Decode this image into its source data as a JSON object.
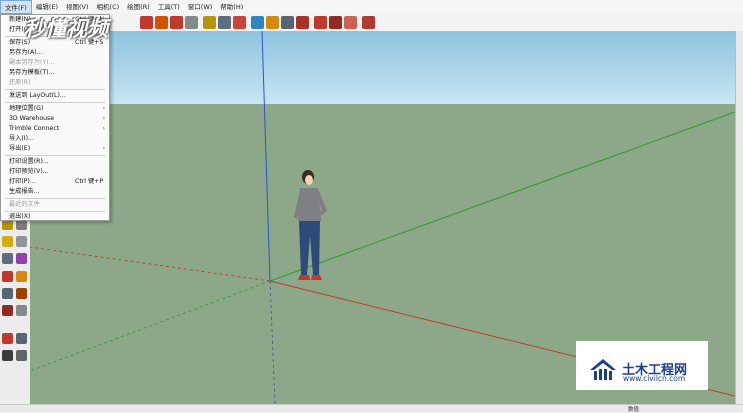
{
  "menu": {
    "items": [
      {
        "label": "文件(F)",
        "active": true
      },
      {
        "label": "编辑(E)"
      },
      {
        "label": "视图(V)"
      },
      {
        "label": "相机(C)"
      },
      {
        "label": "绘图(R)"
      },
      {
        "label": "工具(T)"
      },
      {
        "label": "窗口(W)"
      },
      {
        "label": "帮助(H)"
      }
    ]
  },
  "file_menu": {
    "items": [
      {
        "label": "新建(N)",
        "shortcut": "Ctrl 键+N"
      },
      {
        "label": "打开(O)...",
        "shortcut": ""
      },
      {
        "label": "保存(S)",
        "shortcut": "Ctrl 键+S"
      },
      {
        "label": "另存为(A)...",
        "shortcut": ""
      },
      {
        "label": "副本另存为(Y)...",
        "shortcut": "",
        "disabled": true
      },
      {
        "label": "另存为模板(T)...",
        "shortcut": ""
      },
      {
        "label": "还原(R)",
        "shortcut": "",
        "disabled": true
      },
      {
        "label": "发送到 LayOut(L)...",
        "shortcut": ""
      },
      {
        "label": "地理位置(G)",
        "submenu": true
      },
      {
        "label": "3D Warehouse",
        "submenu": true
      },
      {
        "label": "Trimble Connect",
        "submenu": true
      },
      {
        "label": "导入(I)...",
        "shortcut": ""
      },
      {
        "label": "导出(E)",
        "submenu": true
      },
      {
        "label": "打印设置(R)...",
        "shortcut": ""
      },
      {
        "label": "打印预览(V)...",
        "shortcut": ""
      },
      {
        "label": "打印(P)...",
        "shortcut": "Ctrl 键+P"
      },
      {
        "label": "生成报告...",
        "shortcut": ""
      },
      {
        "label": "最近的文件",
        "shortcut": "",
        "disabled": true
      },
      {
        "label": "退出(X)",
        "shortcut": ""
      }
    ]
  },
  "watermark": {
    "text": "秒懂视频"
  },
  "badge": {
    "text": "土木工程网",
    "url": "www.civilcn.com"
  },
  "status": {
    "right_label": "数值"
  },
  "colors": {
    "sky_top": "#8fc3e0",
    "ground": "#8ca889",
    "axis_red": "#c0392b",
    "axis_green": "#2e9d2e",
    "axis_blue": "#2b57c7",
    "badge_blue": "#1a3f8c"
  }
}
